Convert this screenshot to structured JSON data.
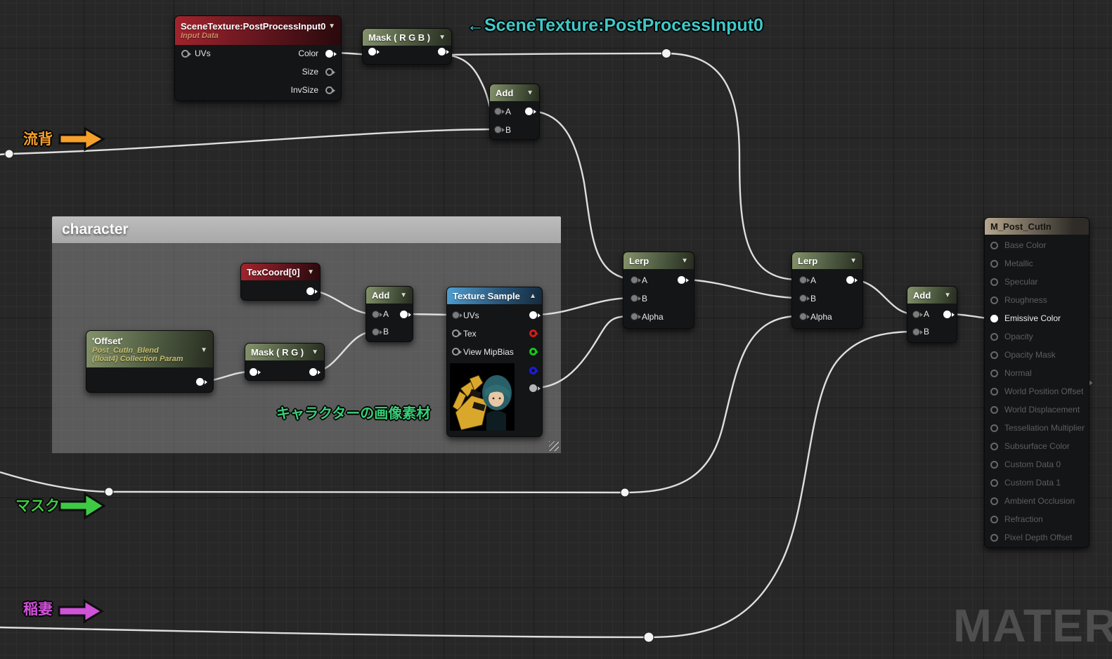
{
  "comment": {
    "title": "character"
  },
  "annotations": {
    "scene_texture_pointer": "←SceneTexture:PostProcessInput0",
    "flow_bg": "流背",
    "mask": "マスク",
    "lightning": "稲妻",
    "character_image_note": "キャラクターの画像素材"
  },
  "nodes": {
    "scene_texture": {
      "title": "SceneTexture:PostProcessInput0",
      "subtitle": "Input Data",
      "in_uvs": "UVs",
      "out_color": "Color",
      "out_size": "Size",
      "out_invsize": "InvSize"
    },
    "mask_rgb": {
      "title": "Mask ( R G B )"
    },
    "add_top": {
      "title": "Add",
      "a": "A",
      "b": "B"
    },
    "texcoord": {
      "title": "TexCoord[0]"
    },
    "offset": {
      "title": "'Offset'",
      "param": "Post_CutIn_Blend",
      "param_type": "(float4) Collection Param"
    },
    "mask_rg": {
      "title": "Mask ( R G )"
    },
    "add_char": {
      "title": "Add",
      "a": "A",
      "b": "B"
    },
    "texture_sample": {
      "title": "Texture Sample",
      "uvs": "UVs",
      "tex": "Tex",
      "mip": "View MipBias"
    },
    "lerp_1": {
      "title": "Lerp",
      "a": "A",
      "b": "B",
      "alpha": "Alpha"
    },
    "lerp_2": {
      "title": "Lerp",
      "a": "A",
      "b": "B",
      "alpha": "Alpha"
    },
    "add_out": {
      "title": "Add",
      "a": "A",
      "b": "B"
    },
    "result": {
      "title": "M_Post_CutIn",
      "pins": [
        "Base Color",
        "Metallic",
        "Specular",
        "Roughness",
        "Emissive Color",
        "Opacity",
        "Opacity Mask",
        "Normal",
        "World Position Offset",
        "World Displacement",
        "Tessellation Multiplier",
        "Subsurface Color",
        "Custom Data 0",
        "Custom Data 1",
        "Ambient Occlusion",
        "Refraction",
        "Pixel Depth Offset"
      ]
    }
  },
  "watermark": "MATERIAL",
  "colors": {
    "annotation_cyan": "#3fc8c8",
    "arrow_orange": "#f5a02a",
    "arrow_green": "#3ec944",
    "arrow_magenta": "#cf52d8",
    "note_green": "#36d077",
    "wire": "#dedede"
  }
}
